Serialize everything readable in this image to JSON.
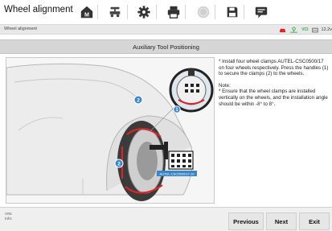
{
  "header": {
    "title": "Wheel alignment",
    "toolbar_icons": [
      "home-icon",
      "car-icon",
      "gear-icon",
      "printer-icon",
      "vehicle-badge-icon",
      "save-icon",
      "chat-icon"
    ]
  },
  "statusbar": {
    "breadcrumb": "Wheel alignment",
    "vci_label": "VCI",
    "battery_text": "12.2v"
  },
  "section": {
    "title": "Auxiliary Tool Positioning"
  },
  "illustration": {
    "callout_1": "1",
    "callout_2": "2",
    "callout_2b": "2",
    "target_label": "AUTEL-CSC0500/17-10"
  },
  "instructions": {
    "step": "* Install four wheel clamps AUTEL-CSC0500/17 on four wheels respectively. Press the handles (1) to secure the clamps (2) to the wheels.",
    "note_title": "Note:",
    "note_body": "* Ensure that the wheel clamps are installed vertically on the wheels, and the installation angle should be within -8° to 8°."
  },
  "footer": {
    "vin_label": "VIN:",
    "info_label": "Info:",
    "previous": "Previous",
    "next": "Next",
    "exit": "Exit"
  },
  "colors": {
    "accent_red": "#d9262b",
    "callout_blue": "#3a86c8",
    "status_green": "#39a64a"
  }
}
